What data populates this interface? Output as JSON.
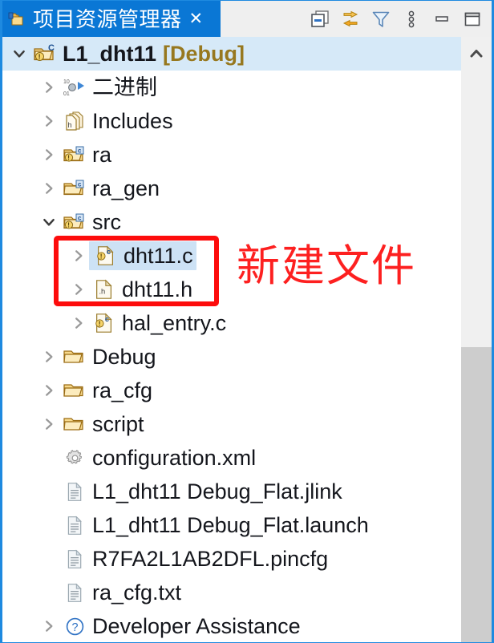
{
  "view": {
    "tab": {
      "title": "项目资源管理器",
      "icon": "project-explorer-icon",
      "close_label": "✕",
      "active_color": "#0a77d5"
    },
    "toolbar": [
      {
        "name": "collapse-all-icon",
        "label": "Collapse All"
      },
      {
        "name": "link-with-editor-icon",
        "label": "Link with Editor"
      },
      {
        "name": "filter-icon",
        "label": "Filters"
      },
      {
        "name": "view-menu-icon",
        "label": "View Menu"
      },
      {
        "name": "minimize-icon",
        "label": "Minimize"
      },
      {
        "name": "maximize-icon",
        "label": "Maximize"
      }
    ]
  },
  "annotation": {
    "text": "新建文件",
    "color": "#fd2020",
    "box_color": "#fd0c0c"
  },
  "scrollbar": {
    "up_arrow": "scroll-up-icon",
    "thumb_color": "#cdcdcd",
    "track_color": "#f0f0f0"
  },
  "tree": {
    "rows": [
      {
        "label": "L1_dht11",
        "suffix": "[Debug]",
        "icon": "c-project-icon",
        "twisty": "expanded",
        "level": 1,
        "bold": true,
        "selected": true
      },
      {
        "label": "二进制",
        "icon": "binaries-icon",
        "twisty": "collapsed",
        "level": 2
      },
      {
        "label": "Includes",
        "icon": "includes-icon",
        "twisty": "collapsed",
        "level": 2
      },
      {
        "label": "ra",
        "icon": "source-folder-icon",
        "twisty": "collapsed",
        "level": 2
      },
      {
        "label": "ra_gen",
        "icon": "source-folder-icon",
        "twisty": "collapsed",
        "level": 2
      },
      {
        "label": "src",
        "icon": "source-folder-icon",
        "twisty": "expanded",
        "level": 2
      },
      {
        "label": "dht11.c",
        "icon": "c-source-file-icon",
        "twisty": "collapsed",
        "level": 3,
        "highlighted": true
      },
      {
        "label": "dht11.h",
        "icon": "h-header-file-icon",
        "twisty": "collapsed",
        "level": 3
      },
      {
        "label": "hal_entry.c",
        "icon": "c-source-file-icon",
        "twisty": "collapsed",
        "level": 3
      },
      {
        "label": "Debug",
        "icon": "folder-icon",
        "twisty": "collapsed",
        "level": 2
      },
      {
        "label": "ra_cfg",
        "icon": "folder-icon",
        "twisty": "collapsed",
        "level": 2
      },
      {
        "label": "script",
        "icon": "folder-icon",
        "twisty": "collapsed",
        "level": 2
      },
      {
        "label": "configuration.xml",
        "icon": "gear-icon",
        "twisty": "none",
        "level": 2
      },
      {
        "label": "L1_dht11 Debug_Flat.jlink",
        "icon": "document-icon",
        "twisty": "none",
        "level": 2
      },
      {
        "label": "L1_dht11 Debug_Flat.launch",
        "icon": "document-icon",
        "twisty": "none",
        "level": 2
      },
      {
        "label": "R7FA2L1AB2DFL.pincfg",
        "icon": "document-icon",
        "twisty": "none",
        "level": 2
      },
      {
        "label": "ra_cfg.txt",
        "icon": "document-icon",
        "twisty": "none",
        "level": 2
      },
      {
        "label": "Developer Assistance",
        "icon": "help-icon",
        "twisty": "collapsed",
        "level": 2
      }
    ]
  }
}
